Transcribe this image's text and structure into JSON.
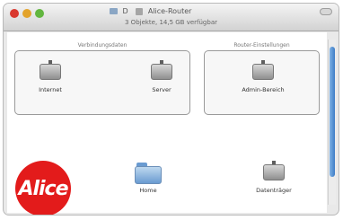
{
  "window": {
    "title_prefix": "D",
    "title_text": "Alice-Router",
    "status_text": "3 Objekte, 14,5 GB verfügbar"
  },
  "panels": [
    {
      "caption": "Verbindungsdaten"
    },
    {
      "caption": "Router-Einstellungen"
    }
  ],
  "items": [
    {
      "label": "Internet"
    },
    {
      "label": "Server"
    },
    {
      "label": "Admin-Bereich"
    },
    {
      "label": "Home"
    },
    {
      "label": "Datenträger"
    }
  ],
  "logo": {
    "text": "Alice",
    "color": "#e31b1b"
  }
}
